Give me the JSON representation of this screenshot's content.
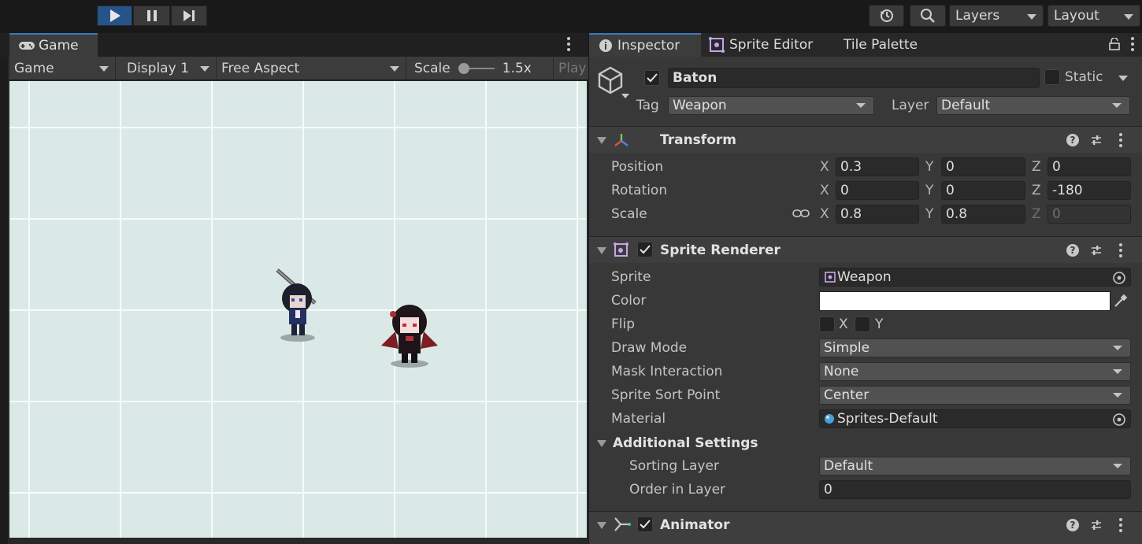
{
  "toolbar": {
    "history_icon": "history-icon",
    "search_icon": "search-icon",
    "layers_label": "Layers",
    "layout_label": "Layout"
  },
  "game_tab": {
    "label": "Game"
  },
  "game_toolbar": {
    "mode": "Game",
    "display": "Display 1",
    "aspect": "Free Aspect",
    "scale_label": "Scale",
    "scale_value": "1.5x",
    "play_label": "Play"
  },
  "inspector_tabs": [
    {
      "label": "Inspector"
    },
    {
      "label": "Sprite Editor"
    },
    {
      "label": "Tile Palette"
    }
  ],
  "object": {
    "name": "Baton",
    "static_label": "Static",
    "tag_label": "Tag",
    "tag_value": "Weapon",
    "layer_label": "Layer",
    "layer_value": "Default"
  },
  "transform": {
    "title": "Transform",
    "position_label": "Position",
    "rotation_label": "Rotation",
    "scale_label": "Scale",
    "axes": {
      "x": "X",
      "y": "Y",
      "z": "Z"
    },
    "position": {
      "x": "0.3",
      "y": "0",
      "z": "0"
    },
    "rotation": {
      "x": "0",
      "y": "0",
      "z": "-180"
    },
    "scale": {
      "x": "0.8",
      "y": "0.8",
      "z": "0"
    }
  },
  "sprite_renderer": {
    "title": "Sprite Renderer",
    "sprite_label": "Sprite",
    "sprite_value": "Weapon",
    "color_label": "Color",
    "color_value": "#ffffff",
    "flip_label": "Flip",
    "flip_x": "X",
    "flip_y": "Y",
    "draw_mode_label": "Draw Mode",
    "draw_mode_value": "Simple",
    "mask_label": "Mask Interaction",
    "mask_value": "None",
    "sort_point_label": "Sprite Sort Point",
    "sort_point_value": "Center",
    "material_label": "Material",
    "material_value": "Sprites-Default",
    "additional_label": "Additional Settings",
    "sorting_layer_label": "Sorting Layer",
    "sorting_layer_value": "Default",
    "order_label": "Order in Layer",
    "order_value": "0"
  },
  "animator": {
    "title": "Animator"
  },
  "colors": {
    "accent": "#3a79bb",
    "play_active": "#26548a",
    "viewport": "#dbe9e6"
  }
}
